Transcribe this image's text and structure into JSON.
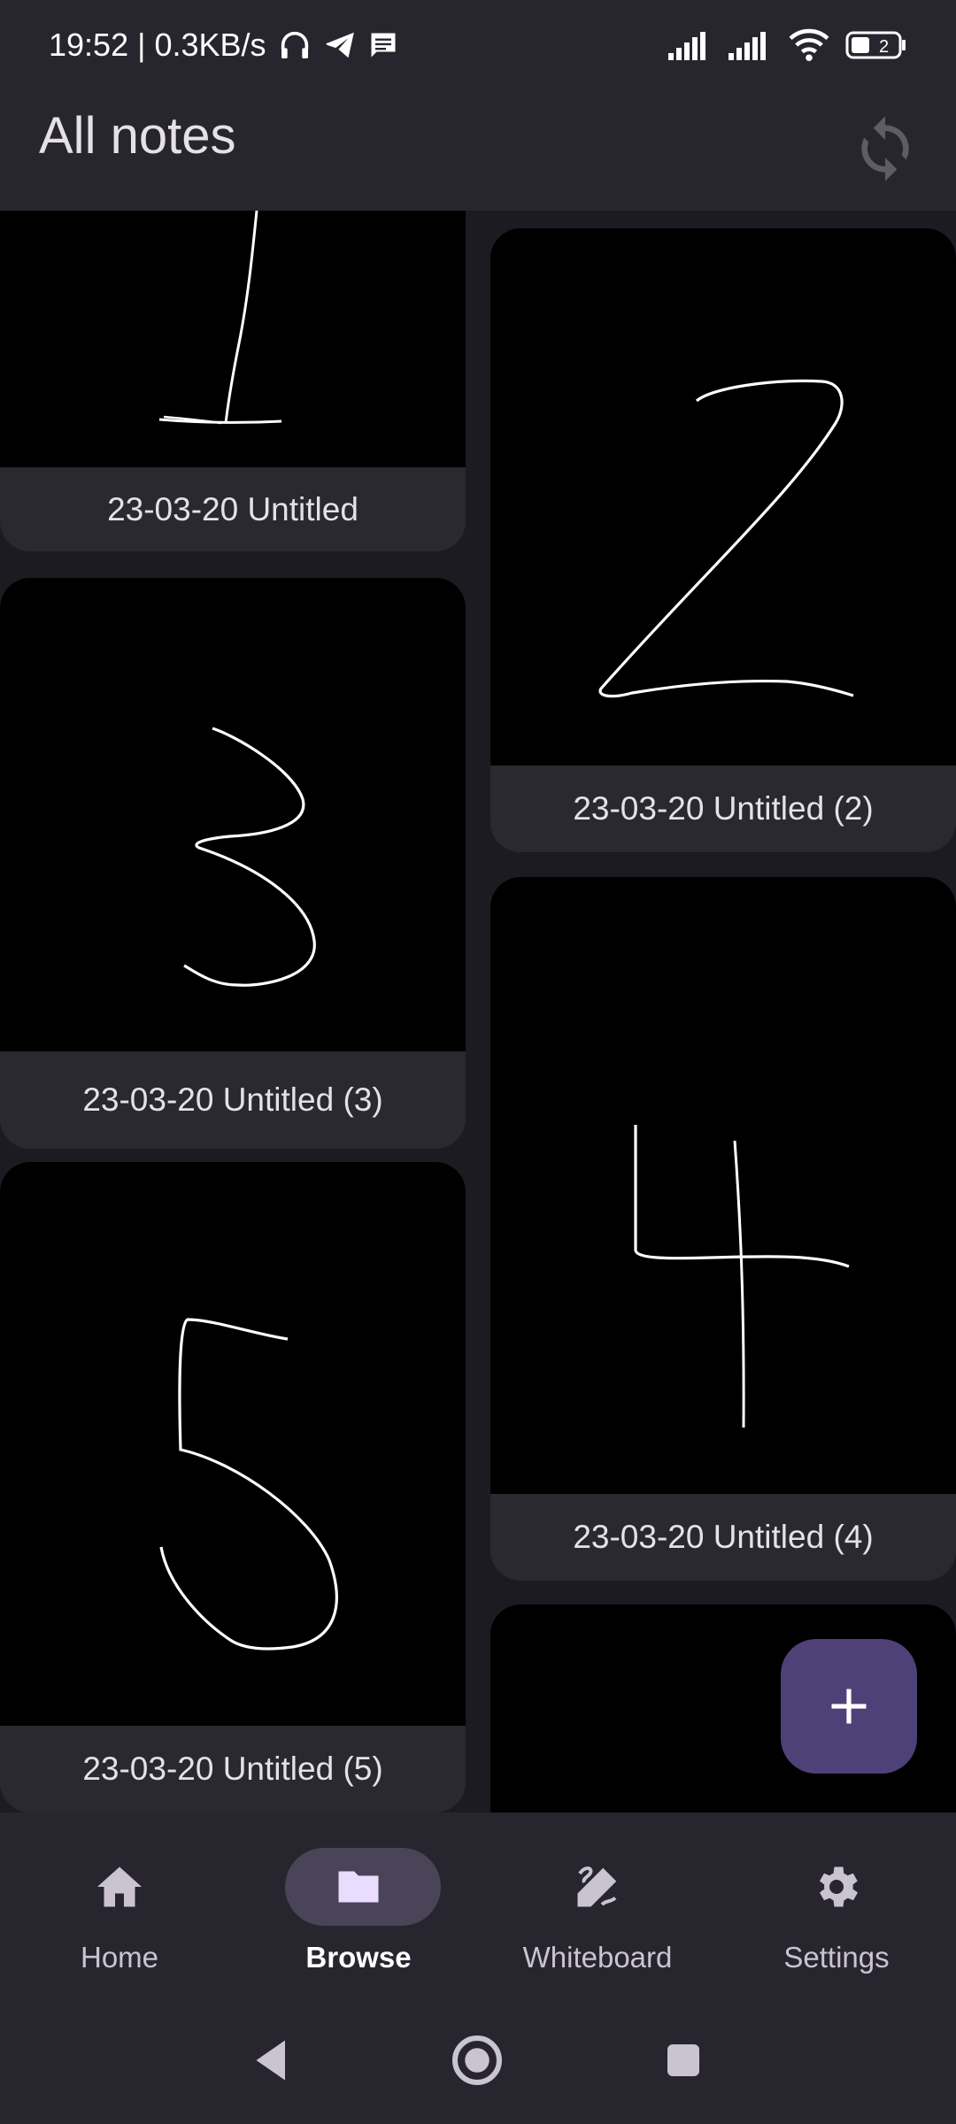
{
  "status_bar": {
    "time_speed": "19:52 | 0.3KB/s",
    "icons": [
      "headphones-icon",
      "telegram-icon",
      "message-icon",
      "signal-icon",
      "signal-icon",
      "wifi-icon",
      "battery-icon"
    ],
    "battery_level": "2"
  },
  "app_bar": {
    "title": "All notes",
    "sync_icon": "sync-icon"
  },
  "notes": [
    {
      "title": "23-03-20 Untitled",
      "drawing": "1"
    },
    {
      "title": "23-03-20 Untitled (2)",
      "drawing": "2"
    },
    {
      "title": "23-03-20 Untitled (3)",
      "drawing": "3"
    },
    {
      "title": "23-03-20 Untitled (4)",
      "drawing": "4"
    },
    {
      "title": "23-03-20 Untitled (5)",
      "drawing": "5"
    },
    {
      "title": "",
      "drawing": ""
    }
  ],
  "fab": {
    "icon": "plus-icon"
  },
  "bottom_nav": [
    {
      "label": "Home",
      "icon": "home-icon",
      "active": false
    },
    {
      "label": "Browse",
      "icon": "folder-icon",
      "active": true
    },
    {
      "label": "Whiteboard",
      "icon": "pen-icon",
      "active": false
    },
    {
      "label": "Settings",
      "icon": "gear-icon",
      "active": false
    }
  ],
  "system_nav": [
    "back-icon",
    "home-circle-icon",
    "recents-icon"
  ],
  "colors": {
    "background": "#1c1b21",
    "surface": "#27262e",
    "card": "#2a2930",
    "fab": "#4e4177",
    "active_pill": "#4a4458"
  }
}
